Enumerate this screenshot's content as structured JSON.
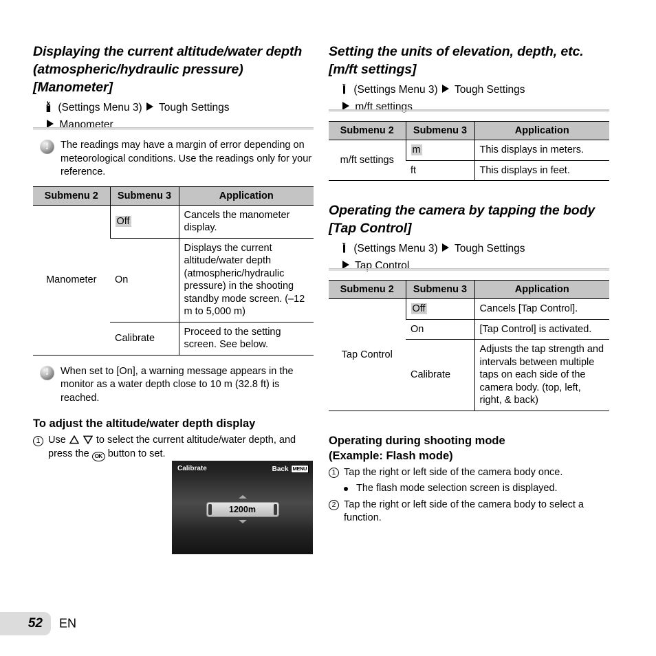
{
  "page": {
    "number": "52",
    "language": "EN"
  },
  "icons": {
    "settings_menu": "wrench-icon",
    "caution": "caution-exclamation-icon",
    "arrow_right": "triangle-right-icon",
    "arrow_up": "triangle-up-icon",
    "arrow_down": "triangle-down-icon",
    "ok_button": "ok-button-icon",
    "menu_badge": "MENU"
  },
  "left_column": {
    "section_manometer": {
      "title": "Displaying the current altitude/water depth (atmospheric/hydraulic pressure) [Manometer]",
      "menu_path": {
        "line1": "(Settings Menu 3)",
        "line1b": "Tough Settings",
        "line2": "Manometer"
      },
      "note": "The readings may have a margin of error depending on meteorological conditions. Use the readings only for your reference.",
      "table": {
        "headers": [
          "Submenu 2",
          "Submenu 3",
          "Application"
        ],
        "submenu2": "Manometer",
        "rows": [
          {
            "submenu3": "Off",
            "highlighted": true,
            "application": "Cancels the manometer display."
          },
          {
            "submenu3": "On",
            "highlighted": false,
            "application": "Displays the current altitude/water depth (atmospheric/hydraulic pressure) in the shooting standby mode screen. (–12 m to 5,000 m)"
          },
          {
            "submenu3": "Calibrate",
            "highlighted": false,
            "application": "Proceed to the setting screen. See below."
          }
        ]
      },
      "note2": "When set to [On], a warning message appears in the monitor as a water depth close to 10 m (32.8 ft) is reached.",
      "sub_heading": "To adjust the altitude/water depth display",
      "step1": {
        "number": "1",
        "text_a": "Use",
        "text_b": "to select the current altitude/water depth, and press the",
        "text_c": "button to set."
      },
      "camera_screen": {
        "title": "Calibrate",
        "back_label": "Back",
        "menu_badge": "MENU",
        "value": "1200m"
      }
    }
  },
  "right_column": {
    "section_mft": {
      "title": "Setting the units of elevation, depth, etc. [m/ft settings]",
      "menu_path": {
        "line1": "(Settings Menu 3)",
        "line1b": "Tough Settings",
        "line2": "m/ft settings"
      },
      "table": {
        "headers": [
          "Submenu 2",
          "Submenu 3",
          "Application"
        ],
        "submenu2": "m/ft settings",
        "rows": [
          {
            "submenu3": "m",
            "highlighted": true,
            "application": "This displays in meters."
          },
          {
            "submenu3": "ft",
            "highlighted": false,
            "application": "This displays in feet."
          }
        ]
      }
    },
    "section_tap": {
      "title": "Operating the camera by tapping the body [Tap Control]",
      "menu_path": {
        "line1": "(Settings Menu 3)",
        "line1b": "Tough Settings",
        "line2": "Tap Control"
      },
      "table": {
        "headers": [
          "Submenu 2",
          "Submenu 3",
          "Application"
        ],
        "submenu2": "Tap Control",
        "rows": [
          {
            "submenu3": "Off",
            "highlighted": true,
            "application": "Cancels [Tap Control]."
          },
          {
            "submenu3": "On",
            "highlighted": false,
            "application": "[Tap Control] is activated."
          },
          {
            "submenu3": "Calibrate",
            "highlighted": false,
            "application": "Adjusts the tap strength and intervals between multiple taps on each side of the camera body. (top, left, right, & back)"
          }
        ]
      }
    },
    "section_shooting": {
      "sub_heading_line1": "Operating during shooting mode",
      "sub_heading_line2": "(Example: Flash mode)",
      "step1": {
        "number": "1",
        "text": "Tap the right or left side of the camera body once."
      },
      "bullet1": "The flash mode selection screen is displayed.",
      "step2": {
        "number": "2",
        "text": "Tap the right or left side of the camera body to select a function."
      }
    }
  }
}
